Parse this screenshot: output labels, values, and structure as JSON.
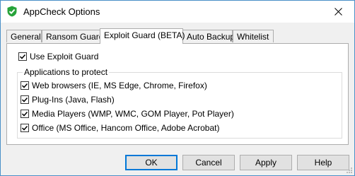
{
  "window": {
    "title": "AppCheck Options"
  },
  "tabs": [
    {
      "label": "General"
    },
    {
      "label": "Ransom Guard"
    },
    {
      "label": "Exploit Guard (BETA)"
    },
    {
      "label": "Auto Backup"
    },
    {
      "label": "Whitelist"
    }
  ],
  "active_tab": "Exploit Guard (BETA)",
  "exploit_guard": {
    "use_label": "Use Exploit Guard",
    "use_checked": true,
    "group_label": "Applications to protect",
    "apps": [
      {
        "label": "Web browsers (IE, MS Edge, Chrome, Firefox)",
        "checked": true
      },
      {
        "label": "Plug-Ins (Java, Flash)",
        "checked": true
      },
      {
        "label": "Media Players (WMP, WMC, GOM Player, Pot Player)",
        "checked": true
      },
      {
        "label": "Office (MS Office, Hancom Office, Adobe Acrobat)",
        "checked": true
      }
    ]
  },
  "buttons": {
    "ok": "OK",
    "cancel": "Cancel",
    "apply": "Apply",
    "help": "Help"
  },
  "colors": {
    "accent": "#0078d7",
    "app_icon": "#27a33a"
  },
  "icons": {
    "app": "appcheck-shield-icon",
    "close": "close-icon",
    "check": "checkmark-icon"
  }
}
